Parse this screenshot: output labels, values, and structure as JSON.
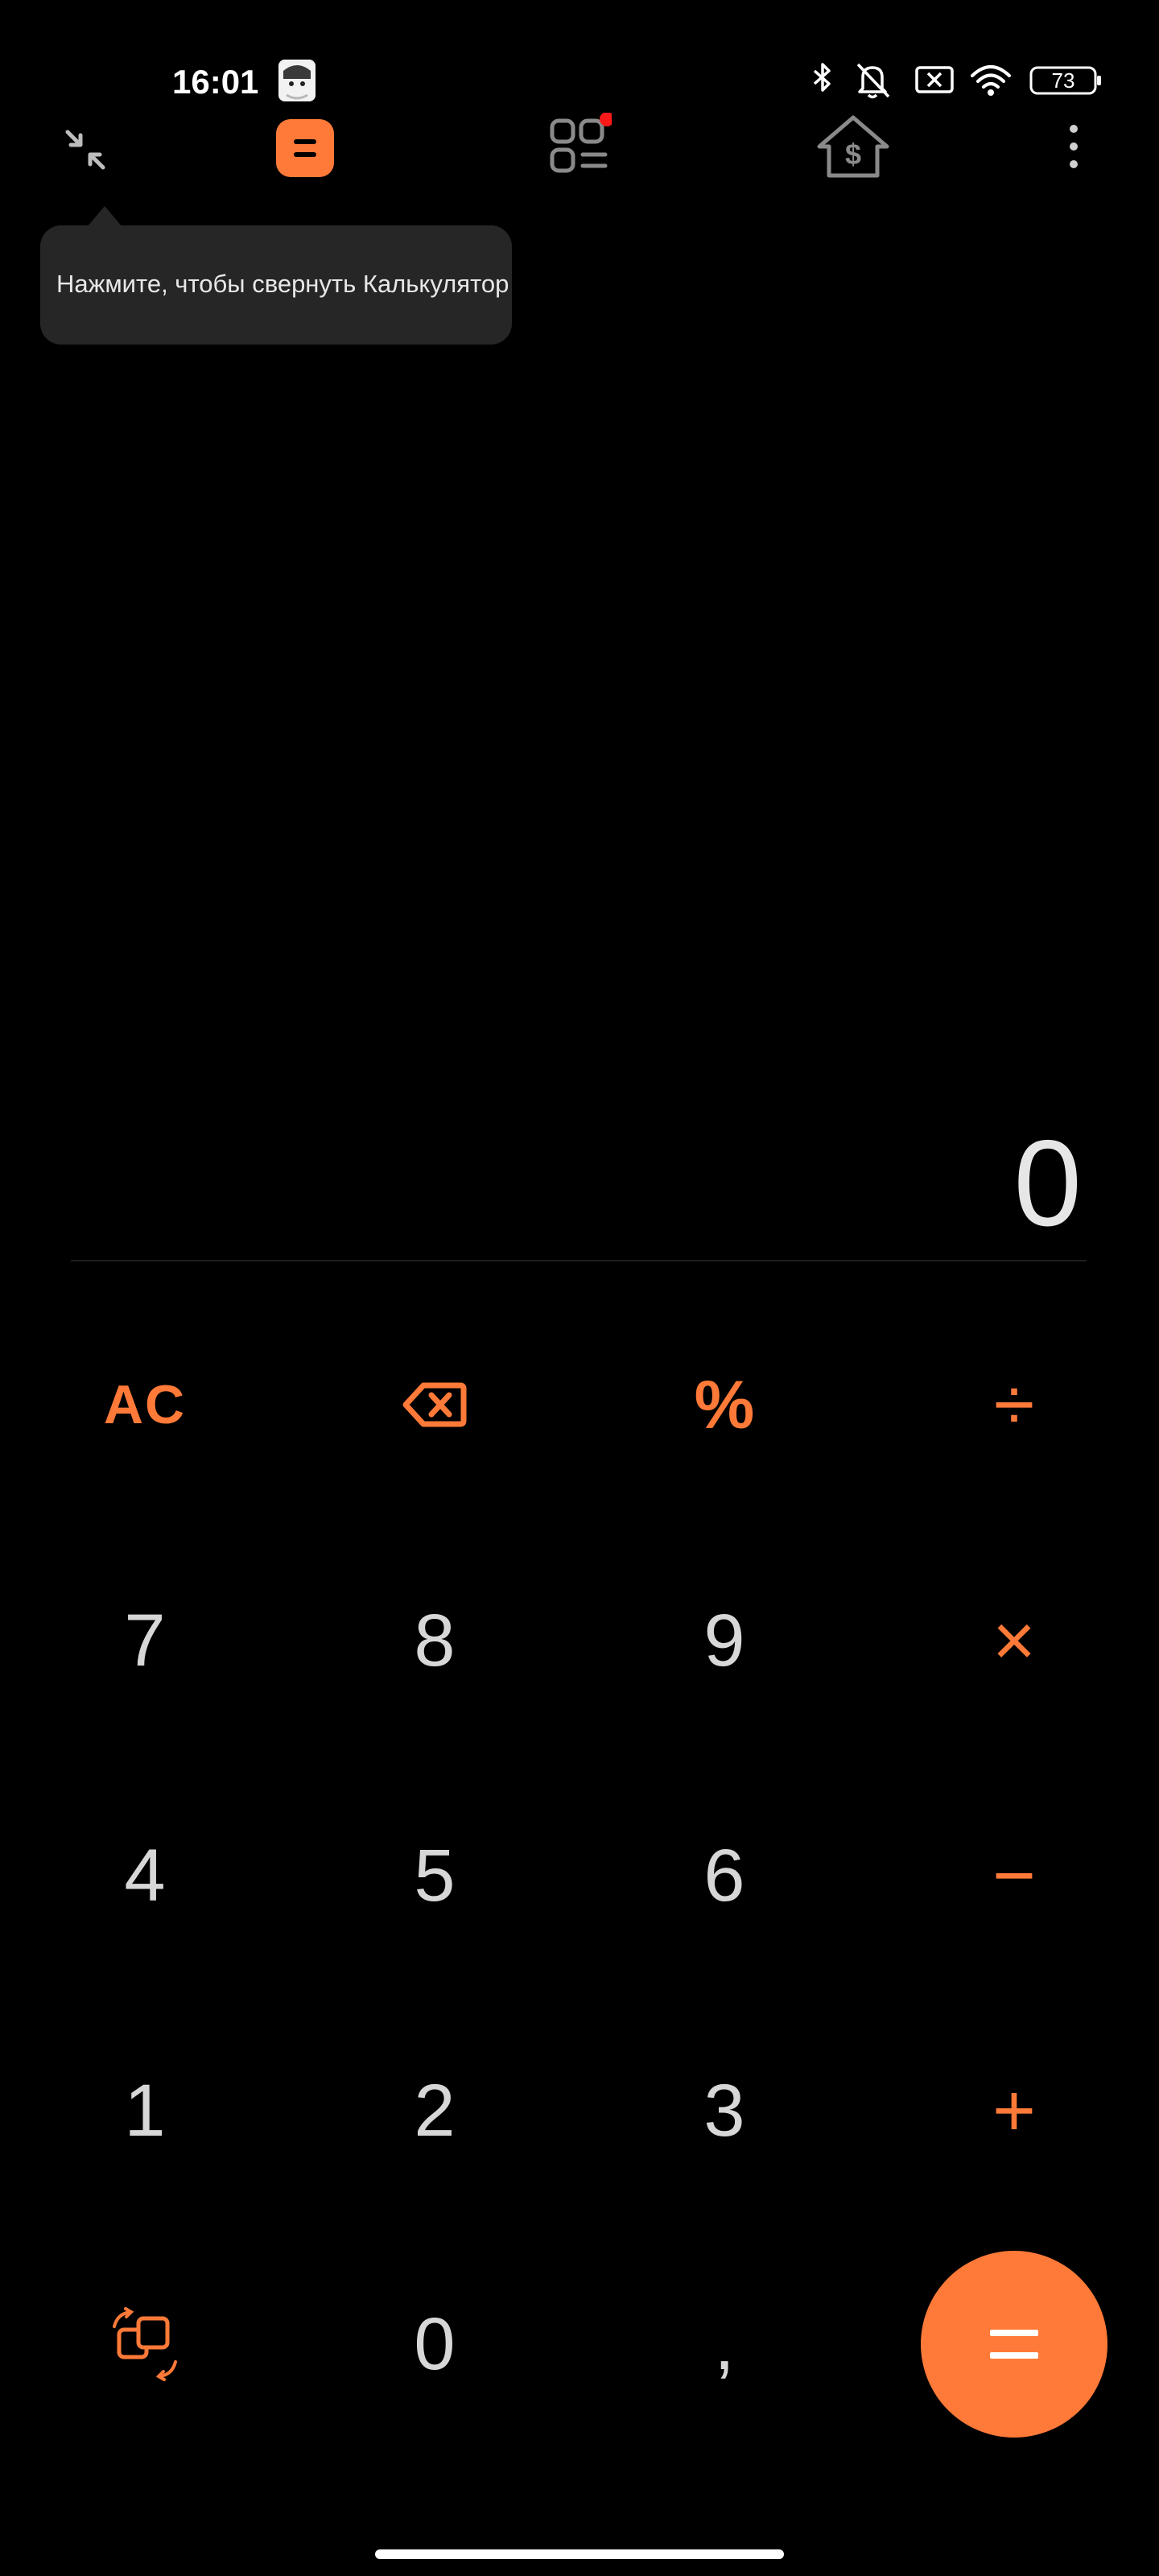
{
  "status_bar": {
    "time": "16:01",
    "battery_level": "73"
  },
  "toolbar": {
    "icons": [
      "collapse-icon",
      "calculator-mode-icon",
      "apps-grid-icon",
      "currency-house-icon",
      "more-icon"
    ]
  },
  "tooltip": {
    "text": "Нажмите, чтобы свернуть Калькулятор"
  },
  "display": {
    "value": "0"
  },
  "keypad": {
    "row1": [
      "AC",
      "backspace-icon",
      "%",
      "÷"
    ],
    "row2": [
      "7",
      "8",
      "9",
      "×"
    ],
    "row3": [
      "4",
      "5",
      "6",
      "−"
    ],
    "row4": [
      "1",
      "2",
      "3",
      "+"
    ],
    "row5": [
      "rotate-icon",
      "0",
      ",",
      "="
    ]
  },
  "labels": {
    "ac": "AC",
    "percent": "%",
    "divide": "÷",
    "multiply": "×",
    "minus": "−",
    "plus": "+",
    "d7": "7",
    "d8": "8",
    "d9": "9",
    "d4": "4",
    "d5": "5",
    "d6": "6",
    "d1": "1",
    "d2": "2",
    "d3": "3",
    "d0": "0",
    "comma": ","
  },
  "colors": {
    "accent": "#ff7a38",
    "background": "#000000",
    "digit": "#d7d7d7",
    "tooltip_bg": "#262626"
  }
}
